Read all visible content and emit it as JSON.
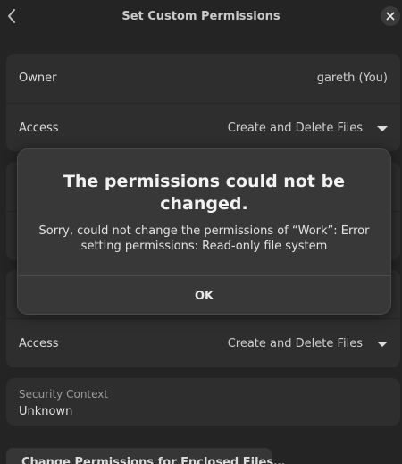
{
  "header": {
    "title": "Set Custom Permissions"
  },
  "owner_card": {
    "owner_label": "Owner",
    "owner_value": "gareth (You)",
    "access_label": "Access",
    "access_value": "Create and Delete Files"
  },
  "others_card": {
    "access_label": "Access",
    "access_value": "Create and Delete Files"
  },
  "security_context": {
    "label": "Security Context",
    "value": "Unknown"
  },
  "enclosed_button": {
    "label": "Change Permissions for Enclosed Files…"
  },
  "dialog": {
    "heading": "The permissions could not be changed.",
    "body": "Sorry, could not change the permissions of “Work”: Error setting permissions: Read-only file system",
    "ok_label": "OK"
  },
  "colors": {
    "background": "#242424",
    "card": "#2e2e2e",
    "dialog": "#383838"
  }
}
